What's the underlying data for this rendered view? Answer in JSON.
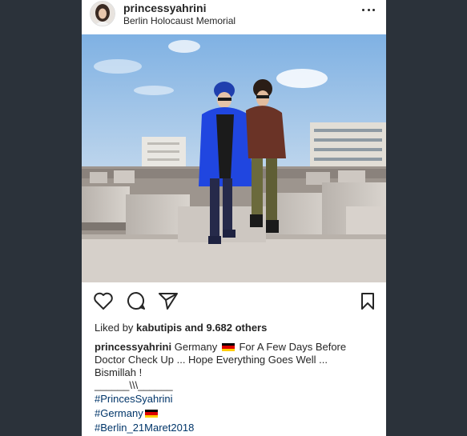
{
  "post": {
    "username": "princessyahrini",
    "location": "Berlin Holocaust Memorial",
    "likes_prefix": "Liked by",
    "likes_user": "kabutipis",
    "likes_suffix": "and 9.682 others",
    "caption": {
      "author": "princessyahrini",
      "text_1": "Germany",
      "text_2": "For A Few Days Before",
      "line_2": "Doctor Check Up ... Hope Everything Goes Well ...",
      "line_3": "Bismillah !",
      "line_4": "______\\\\\\______",
      "hashtags": [
        "#PrincesSyahrini",
        "#Germany",
        "#Berlin_21Maret2018"
      ]
    }
  },
  "icons": {
    "more": "more-dots-icon",
    "like": "heart-icon",
    "comment": "comment-icon",
    "share": "share-icon",
    "save": "bookmark-icon",
    "flag": "germany-flag-icon"
  },
  "colors": {
    "background": "#2b323a",
    "card": "#ffffff",
    "hashtag": "#003569",
    "text": "#262626"
  }
}
